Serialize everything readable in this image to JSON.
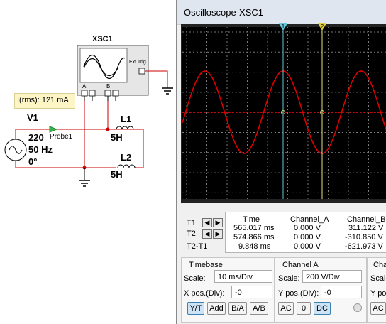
{
  "schematic": {
    "scope_name": "XSC1",
    "ext_trig_label": "Ext Trig",
    "channel_a_terminal": "A",
    "channel_b_terminal": "B",
    "probe_tooltip": "I(rms): 121 mA",
    "probe_name": "Probe1",
    "source": {
      "name": "V1",
      "voltage": "220",
      "frequency": "50 Hz",
      "phase": "0°"
    },
    "inductor1": {
      "name": "L1",
      "value": "5H"
    },
    "inductor2": {
      "name": "L2",
      "value": "5H"
    },
    "wire_color": "#cc0000"
  },
  "scope_window": {
    "title": "Oscilloscope-XSC1",
    "cursor1_label": "1",
    "cursor2_label": "2",
    "trace_color": "#dd0000",
    "readout": {
      "headers": [
        "",
        "Time",
        "Channel_A",
        "Channel_B"
      ],
      "rows": [
        {
          "label": "T1",
          "time": "565.017 ms",
          "channel_a": "0.000 V",
          "channel_b": "311.122 V"
        },
        {
          "label": "T2",
          "time": "574.866 ms",
          "channel_a": "0.000 V",
          "channel_b": "-310.850 V"
        },
        {
          "label": "T2-T1",
          "time": "9.848 ms",
          "channel_a": "0.000 V",
          "channel_b": "-621.973 V"
        }
      ]
    },
    "timebase": {
      "title": "Timebase",
      "scale_label": "Scale:",
      "scale_value": "10 ms/Div",
      "xpos_label": "X pos.(Div):",
      "xpos_value": "-0",
      "buttons": [
        "Y/T",
        "Add",
        "B/A",
        "A/B"
      ]
    },
    "channel_a": {
      "title": "Channel A",
      "scale_label": "Scale:",
      "scale_value": "200  V/Div",
      "ypos_label": "Y pos.(Div):",
      "ypos_value": "-0",
      "buttons": [
        "AC",
        "0",
        "DC"
      ]
    },
    "channel_b": {
      "title": "Cha",
      "scale_label": "Scale",
      "ypos_label": "Y pos",
      "buttons": [
        "AC"
      ]
    }
  }
}
